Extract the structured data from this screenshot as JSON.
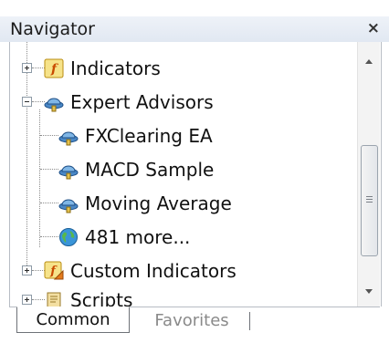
{
  "window": {
    "title": "Navigator"
  },
  "tree": {
    "items": [
      {
        "label": "Indicators",
        "icon": "indicator-icon",
        "expander": "collapsed"
      },
      {
        "label": "Expert Advisors",
        "icon": "expert-advisor-icon",
        "expander": "expanded"
      },
      {
        "label": "FXClearing EA",
        "icon": "expert-advisor-icon"
      },
      {
        "label": "MACD Sample",
        "icon": "expert-advisor-icon"
      },
      {
        "label": "Moving Average",
        "icon": "expert-advisor-icon"
      },
      {
        "label": "481 more...",
        "icon": "globe-icon"
      },
      {
        "label": "Custom Indicators",
        "icon": "custom-indicator-icon",
        "expander": "collapsed"
      },
      {
        "label": "Scripts",
        "icon": "script-icon",
        "expander": "collapsed"
      }
    ]
  },
  "tabs": [
    {
      "label": "Common",
      "active": true
    },
    {
      "label": "Favorites",
      "active": false
    }
  ]
}
